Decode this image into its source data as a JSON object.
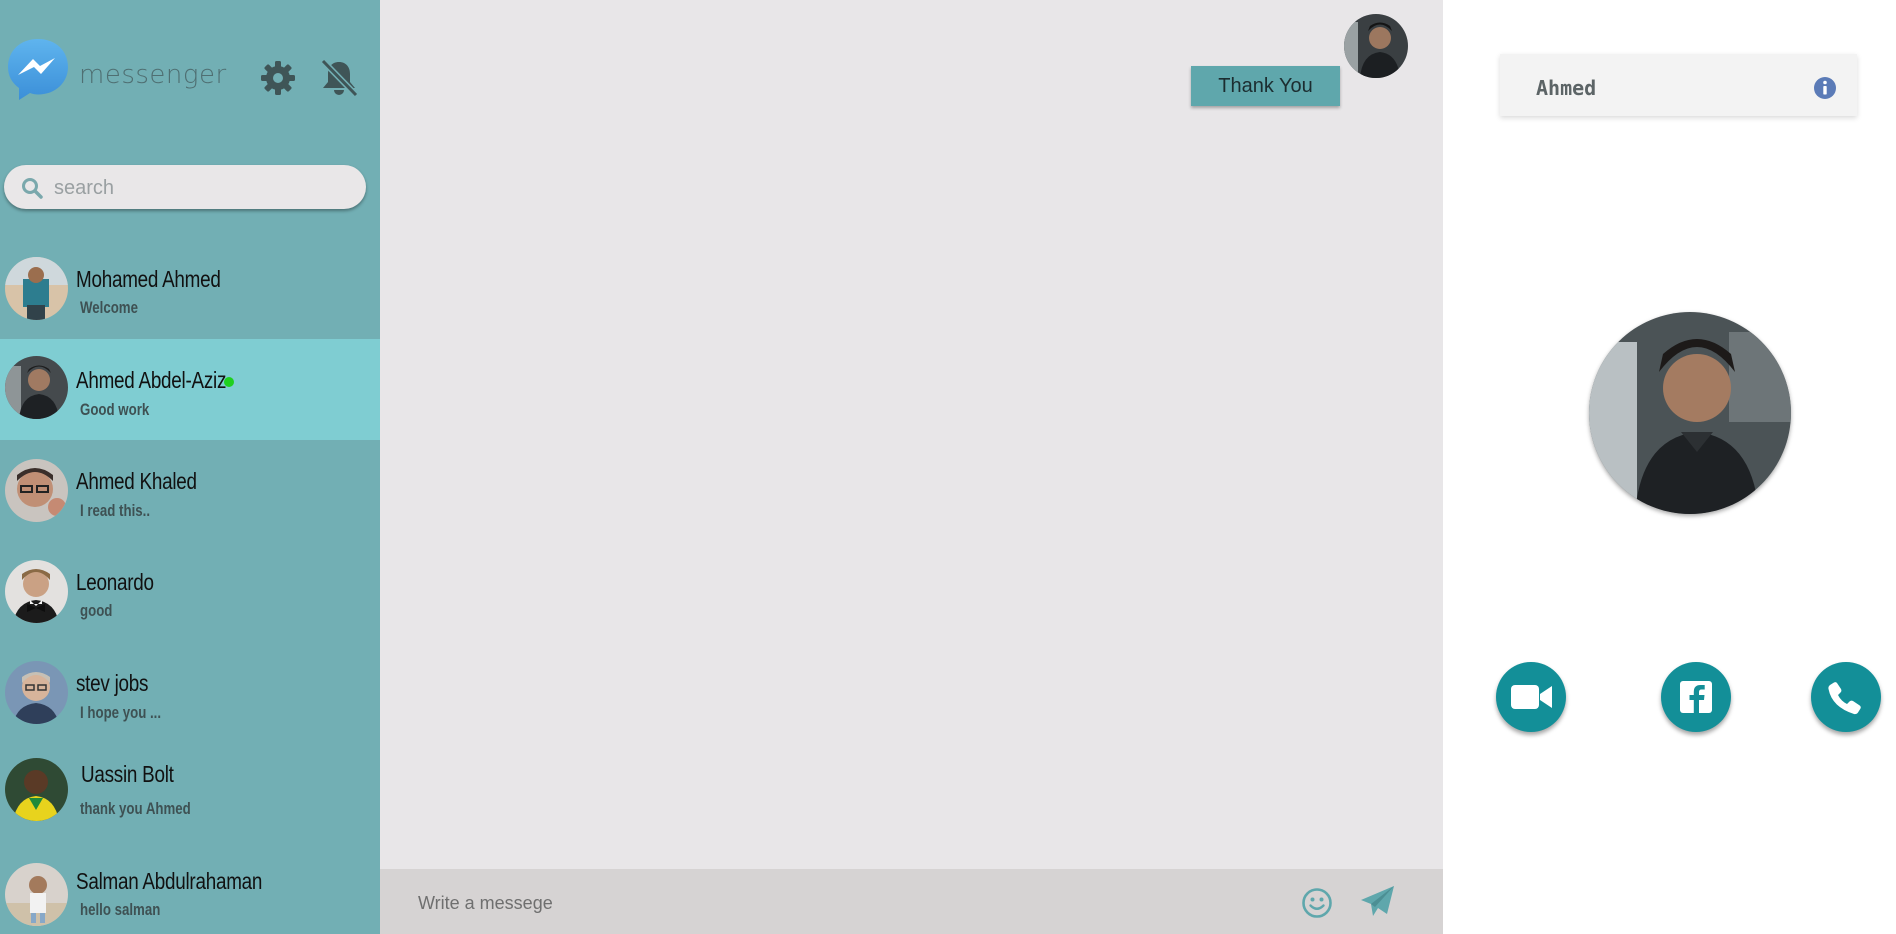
{
  "sidebar": {
    "brand": "messenger",
    "search_placeholder": "search",
    "contacts": [
      {
        "name": "Mohamed Ahmed",
        "last_message": "Welcome",
        "online": false,
        "active": false
      },
      {
        "name": "Ahmed Abdel-Aziz",
        "last_message": "Good work",
        "online": true,
        "active": true
      },
      {
        "name": "Ahmed Khaled",
        "last_message": "I read this..",
        "online": false,
        "active": false
      },
      {
        "name": "Leonardo",
        "last_message": "good",
        "online": false,
        "active": false
      },
      {
        "name": "stev jobs",
        "last_message": "I hope you ...",
        "online": false,
        "active": false
      },
      {
        "name": "Uassin Bolt",
        "last_message": "thank you Ahmed",
        "online": false,
        "active": false
      },
      {
        "name": "Salman Abdulrahaman",
        "last_message": "hello salman",
        "online": false,
        "active": false
      }
    ]
  },
  "chat": {
    "messages": [
      {
        "text": "Thank You",
        "from": "me"
      }
    ],
    "composer_placeholder": "Write a messege"
  },
  "profile": {
    "name": "Ahmed"
  },
  "colors": {
    "sidebar_bg": "#72afb4",
    "active_contact": "#7fcdd2",
    "chat_bg": "#e8e6e8",
    "bubble": "#5fa7ac",
    "action_button": "#138f98",
    "online_dot": "#1fd01f"
  },
  "icons": {
    "logo": "messenger-logo",
    "settings": "gear-icon",
    "mute": "bell-slash-icon",
    "search": "search-icon",
    "emoji": "smiley-icon",
    "send": "paper-plane-icon",
    "info": "info-icon",
    "video": "video-camera-icon",
    "facebook": "facebook-icon",
    "phone": "phone-icon"
  }
}
